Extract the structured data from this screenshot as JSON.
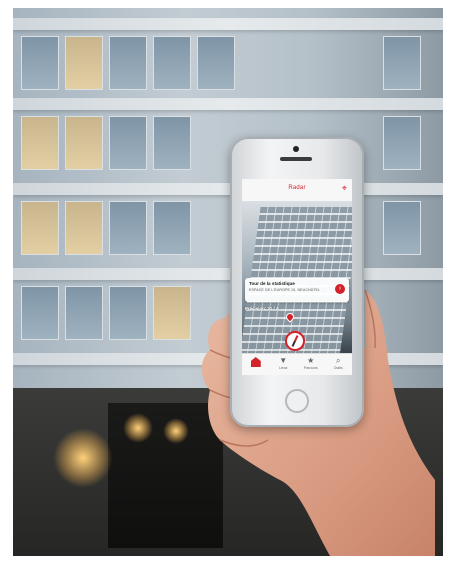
{
  "app": {
    "title": "Radar",
    "header_icon": "location-pin-icon",
    "accent_color": "#d2232a"
  },
  "poi": {
    "title": "Tour de la statistique",
    "subtitle": "ESPACE DE L'EUROPE 10, NEUCHÂTEL",
    "distance": "Précision: 21 / A"
  },
  "tabs": [
    {
      "label": "",
      "icon": "city-logo-icon",
      "active": true
    },
    {
      "label": "Lieux",
      "icon": "map-pin-icon",
      "active": false
    },
    {
      "label": "Parcours",
      "icon": "walker-icon",
      "active": false
    },
    {
      "label": "Outils",
      "icon": "search-icon",
      "active": false
    }
  ]
}
